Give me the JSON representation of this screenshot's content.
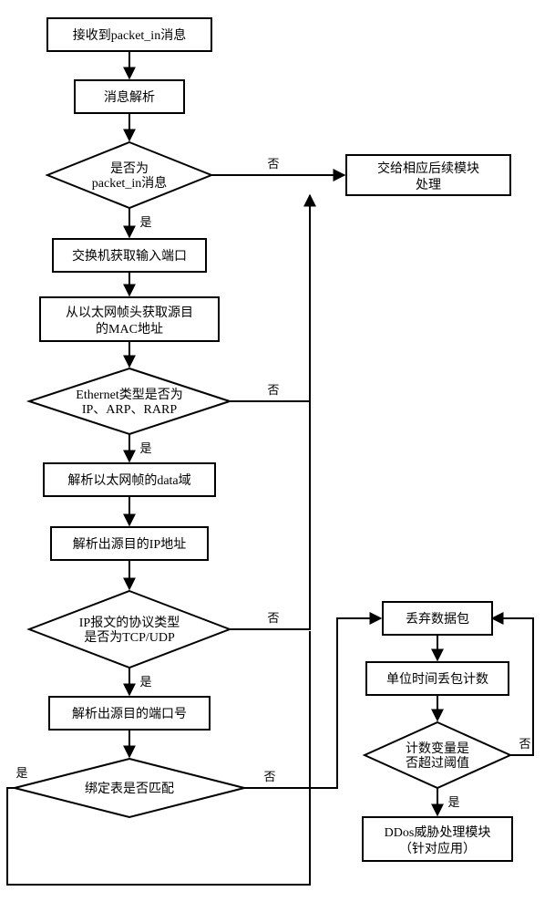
{
  "nodes": {
    "n1": "接收到packet_in消息",
    "n2": "消息解析",
    "d1a": "是否为",
    "d1b": "packet_in消息",
    "n3": "交换机获取输入端口",
    "n4a": "从以太网帧头获取源目",
    "n4b": "的MAC地址",
    "d2a": "Ethernet类型是否为",
    "d2b": "IP、ARP、RARP",
    "n5": "解析以太网帧的data域",
    "n6": "解析出源目的IP地址",
    "d3a": "IP报文的协议类型",
    "d3b": "是否为TCP/UDP",
    "n7": "解析出源目的端口号",
    "d4": "绑定表是否匹配",
    "r1a": "交给相应后续模块",
    "r1b": "处理",
    "r2": "丢弃数据包",
    "r3": "单位时间丢包计数",
    "d5a": "计数变量是",
    "d5b": "否超过阈值",
    "r4a": "DDos威胁处理模块",
    "r4b": "（针对应用）"
  },
  "labels": {
    "yes": "是",
    "no": "否"
  }
}
